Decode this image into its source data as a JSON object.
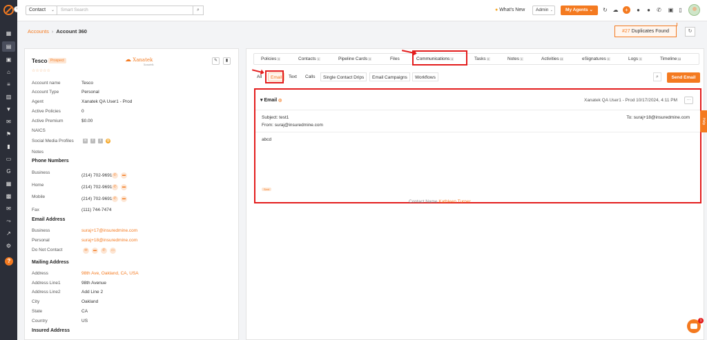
{
  "topbar": {
    "search_type": "Contact",
    "search_placeholder": "Smart Search",
    "whats_new": "What's New",
    "role": "Admin",
    "my_agents": "My Agents"
  },
  "breadcrumb": {
    "parent": "Accounts",
    "current": "Account 360"
  },
  "duplicates": {
    "count": "#27",
    "label": "Duplicates Found"
  },
  "account": {
    "name": "Tesco",
    "status": "Prospect",
    "logo_text": "Xanatek",
    "logo_sub": "Xanatek",
    "fields": [
      {
        "label": "Account name",
        "value": "Tesco"
      },
      {
        "label": "Account Type",
        "value": "Personal"
      },
      {
        "label": "Agent",
        "value": "Xanatek QA User1 - Prod"
      },
      {
        "label": "Active Policies",
        "value": "0"
      },
      {
        "label": "Active Premium",
        "value": "$0.00"
      },
      {
        "label": "NAICS",
        "value": ""
      },
      {
        "label": "Social Media Profiles",
        "value": ""
      },
      {
        "label": "Notes",
        "value": ""
      }
    ],
    "phone_section": "Phone Numbers",
    "phones": [
      {
        "label": "Business",
        "value": "(214) 702-9691"
      },
      {
        "label": "Home",
        "value": "(214) 702-9691"
      },
      {
        "label": "Mobile",
        "value": "(214) 702-9691"
      },
      {
        "label": "Fax",
        "value": "(111) 744-7474"
      }
    ],
    "email_section": "Email Address",
    "emails": [
      {
        "label": "Business",
        "value": "suraj+17@insuredmine.com"
      },
      {
        "label": "Personal",
        "value": "suraj+18@insuredmine.com"
      },
      {
        "label": "Do Not Contact",
        "value": ""
      }
    ],
    "mailing_section": "Mailing Address",
    "mailing": [
      {
        "label": "Address",
        "value": "98th Ave, Oakland, CA, USA"
      },
      {
        "label": "Address Line1",
        "value": "98th Avenue"
      },
      {
        "label": "Address Line2",
        "value": "Add Line 2"
      },
      {
        "label": "City",
        "value": "Oakland"
      },
      {
        "label": "State",
        "value": "CA"
      },
      {
        "label": "Country",
        "value": "US"
      }
    ],
    "insured_section": "Insured Address"
  },
  "tabs": [
    {
      "label": "Policies",
      "count": "0"
    },
    {
      "label": "Contacts",
      "count": "1"
    },
    {
      "label": "Pipeline Cards",
      "count": "0"
    },
    {
      "label": "Files",
      "count": ""
    },
    {
      "label": "Communications",
      "count": "4"
    },
    {
      "label": "Tasks",
      "count": "0"
    },
    {
      "label": "Notes",
      "count": "1"
    },
    {
      "label": "Activities",
      "count": "13"
    },
    {
      "label": "eSignatures",
      "count": "0"
    },
    {
      "label": "Logs",
      "count": "3"
    },
    {
      "label": "Timeline",
      "count": "18"
    }
  ],
  "subtabs": [
    "All",
    "Email",
    "Text",
    "Calls",
    "Single Contact Drips",
    "Email Campaigns",
    "Workflows"
  ],
  "send_email": "Send Email",
  "email": {
    "title": "Email",
    "meta": "Xanatek QA User1 - Prod 10/17/2024, 4:11 PM",
    "subject": "Subject: test1",
    "from": "From: suraj@insuredmine.com",
    "to": "To: suraj+18@insuredmine.com",
    "body": "abcd",
    "tag": "Sent"
  },
  "contact_name": {
    "label": "Contact Name",
    "value": "Kathleen Turner"
  },
  "feedback": "Help",
  "chat_badge": "1",
  "colors": {
    "accent": "#f47a20",
    "highlight": "#e31b1b",
    "sidebar": "#2b2e38"
  }
}
